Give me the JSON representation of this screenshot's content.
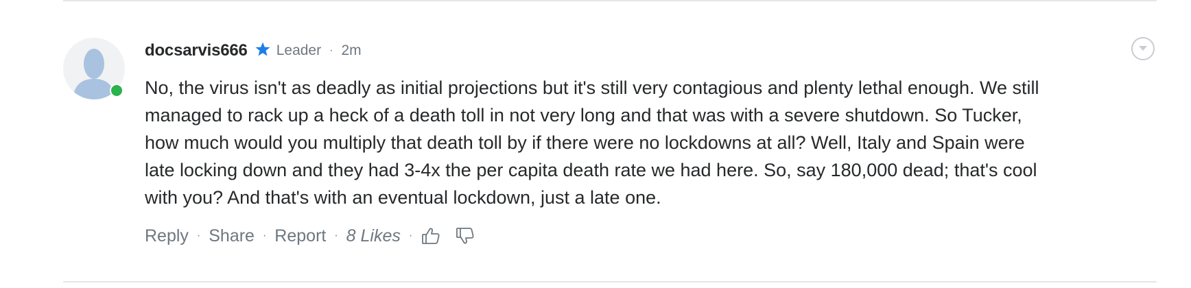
{
  "comment": {
    "username": "docsarvis666",
    "badge": "Leader",
    "meta_separator": "·",
    "time": "2m",
    "body": "No, the virus isn't as deadly as initial projections but it's still very contagious and plenty lethal enough.  We still\nmanaged to rack up a heck of a death toll in not very long and that was with a severe shutdown.   So Tucker,\nhow much would you multiply that death toll by if there were no lockdowns at all?  Well, Italy and Spain were\nlate locking down and they had 3-4x the per capita death rate we had here.  So, say 180,000 dead; that's cool\nwith you?  And that's with an eventual lockdown, just a late one.",
    "online": true
  },
  "actions": {
    "reply": "Reply",
    "share": "Share",
    "report": "Report",
    "likes": "8 Likes",
    "separator": "·"
  },
  "icons": {
    "star": "star-icon",
    "menu": "chevron-down-icon",
    "thumbs_up": "thumbs-up-icon",
    "thumbs_down": "thumbs-down-icon"
  },
  "colors": {
    "star": "#1e7ee6",
    "online": "#2ab24b",
    "avatar_bg": "#f1f2f4",
    "avatar_figure": "#a9c2df",
    "muted_text": "#6e7780",
    "text": "#26282a"
  }
}
